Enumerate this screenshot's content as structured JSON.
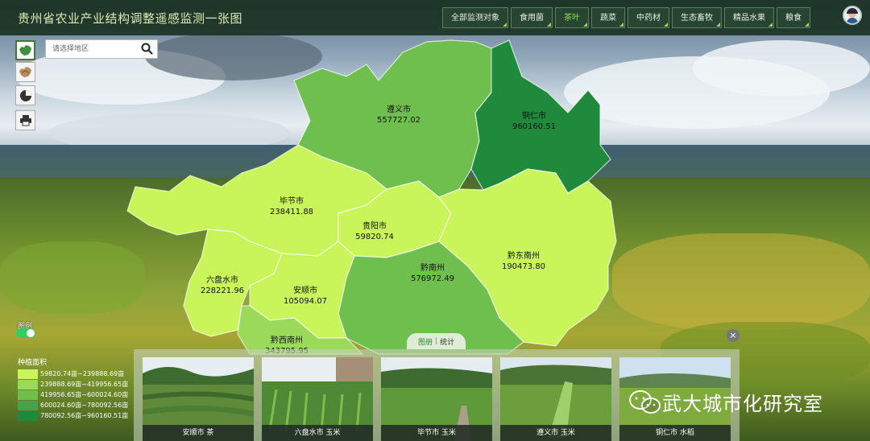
{
  "header": {
    "title": "贵州省农业产业结构调整遥感监测一张图",
    "tabs": [
      {
        "label": "全部监测对象",
        "active": false
      },
      {
        "label": "食用菌",
        "active": false
      },
      {
        "label": "茶叶",
        "active": true
      },
      {
        "label": "蔬菜",
        "active": false
      },
      {
        "label": "中药材",
        "active": false
      },
      {
        "label": "生态畜牧",
        "active": false
      },
      {
        "label": "精品水果",
        "active": false
      },
      {
        "label": "粮食",
        "active": false
      }
    ]
  },
  "toolbar": {
    "tools": [
      {
        "name": "map-view-tool-icon"
      },
      {
        "name": "land-view-tool-icon"
      },
      {
        "name": "pie-chart-tool-icon"
      },
      {
        "name": "print-tool-icon"
      }
    ]
  },
  "search": {
    "placeholder": "请选择地区"
  },
  "regions": [
    {
      "name": "遵义市",
      "value": "557727.02",
      "color": "#6fbf4f"
    },
    {
      "name": "铜仁市",
      "value": "960160.51",
      "color": "#1f8a3c"
    },
    {
      "name": "毕节市",
      "value": "238411.88",
      "color": "#c9f55a"
    },
    {
      "name": "贵阳市",
      "value": "59820.74",
      "color": "#c9f55a"
    },
    {
      "name": "黔东南州",
      "value": "190473.80",
      "color": "#c9f55a"
    },
    {
      "name": "黔南州",
      "value": "576972.49",
      "color": "#6fbf4f"
    },
    {
      "name": "六盘水市",
      "value": "228221.96",
      "color": "#c9f55a"
    },
    {
      "name": "安顺市",
      "value": "105094.07",
      "color": "#c9f55a"
    },
    {
      "name": "黔西南州",
      "value": "343795.95",
      "color": "#9bd95a"
    }
  ],
  "legend": {
    "toggle_label": "图例",
    "title": "种植面积",
    "items": [
      {
        "label": "59820.74亩~239888.69亩",
        "color": "#c9f55a"
      },
      {
        "label": "239888.69亩~419956.65亩",
        "color": "#9bd95a"
      },
      {
        "label": "419956.65亩~600024.60亩",
        "color": "#6fbf4f"
      },
      {
        "label": "600024.60亩~780092.56亩",
        "color": "#43a449"
      },
      {
        "label": "780092.56亩~960160.51亩",
        "color": "#1f8a3c"
      }
    ]
  },
  "panel": {
    "tabs": [
      {
        "label": "图册",
        "active": true
      },
      {
        "label": "统计",
        "active": false
      }
    ],
    "separator": "|",
    "close_symbol": "×",
    "photos": [
      {
        "caption": "安顺市 茶"
      },
      {
        "caption": "六盘水市 玉米"
      },
      {
        "caption": "毕节市 玉米"
      },
      {
        "caption": "遵义市 玉米"
      },
      {
        "caption": "铜仁市 水稻"
      }
    ]
  },
  "watermark": {
    "text": "武大城市化研究室"
  }
}
